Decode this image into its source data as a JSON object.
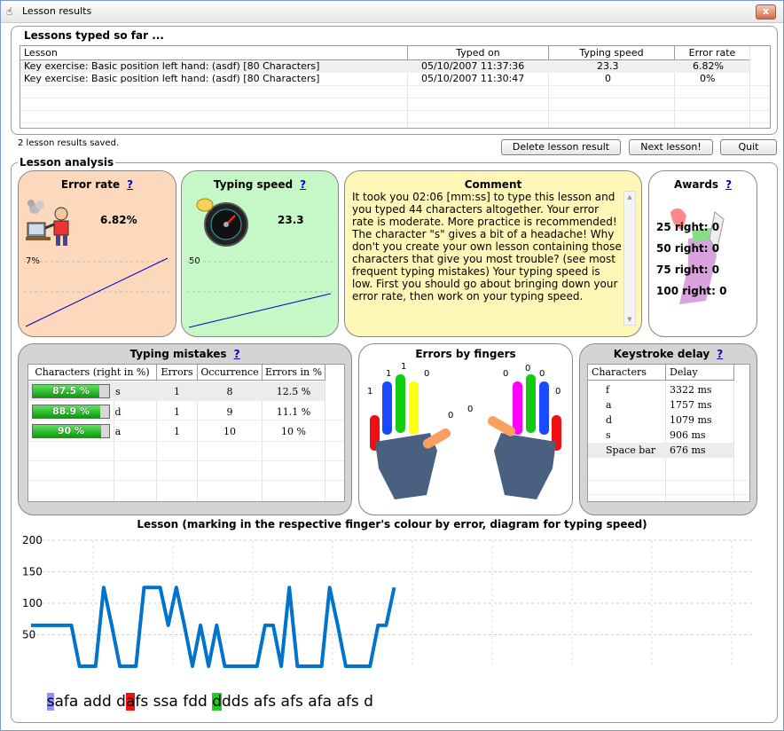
{
  "window": {
    "title": "Lesson results",
    "close": "x"
  },
  "lessons": {
    "title": "Lessons typed so far ...",
    "columns": [
      "Lesson",
      "Typed on",
      "Typing speed",
      "Error rate"
    ],
    "rows": [
      {
        "lesson": "Key exercise: Basic position left hand: (asdf) [80 Characters]",
        "typed_on": "05/10/2007 11:37:36",
        "speed": "23.3",
        "error": "6.82%"
      },
      {
        "lesson": "Key exercise: Basic position left hand: (asdf) [80 Characters]",
        "typed_on": "05/10/2007 11:30:47",
        "speed": "0",
        "error": "0%"
      }
    ],
    "status": "2 lesson results saved."
  },
  "buttons": {
    "delete": "Delete lesson result",
    "next": "Next lesson!",
    "quit": "Quit"
  },
  "analysis": {
    "title": "Lesson analysis",
    "help": "?",
    "error_rate": {
      "title": "Error rate",
      "value": "6.82%",
      "axis_label": "7%"
    },
    "typing_speed": {
      "title": "Typing speed",
      "value": "23.3",
      "axis_label": "50"
    },
    "comment": {
      "title": "Comment",
      "text": "It took you 02:06 [mm:ss] to type this lesson and you typed 44 characters altogether. Your error rate is moderate. More practice is recommended! The character \"s\" gives a bit of a headache! Why don't you create your own lesson containing those characters that give you most trouble? (see most frequent typing mistakes) Your typing speed is low. First you should go about bringing down your error rate, then work on your typing speed."
    },
    "awards": {
      "title": "Awards",
      "rows": [
        "25 right: 0",
        "50 right: 0",
        "75 right: 0",
        "100 right: 0"
      ]
    },
    "mistakes": {
      "title": "Typing mistakes",
      "columns": [
        "Characters (right in %)",
        "Errors",
        "Occurrence",
        "Errors in %"
      ],
      "rows": [
        {
          "pct_label": "87.5 %",
          "pct": 87.5,
          "char": "s",
          "errors": "1",
          "occ": "8",
          "epct": "12.5 %"
        },
        {
          "pct_label": "88.9 %",
          "pct": 88.9,
          "char": "d",
          "errors": "1",
          "occ": "9",
          "epct": "11.1 %"
        },
        {
          "pct_label": "90 %",
          "pct": 90,
          "char": "a",
          "errors": "1",
          "occ": "10",
          "epct": "10 %"
        }
      ]
    },
    "fingers": {
      "title": "Errors by fingers",
      "left": [
        "1",
        "1",
        "1",
        "0",
        "0"
      ],
      "right": [
        "0",
        "0",
        "0",
        "0",
        "0"
      ]
    },
    "keystroke": {
      "title": "Keystroke delay",
      "columns": [
        "Characters",
        "Delay"
      ],
      "rows": [
        {
          "ch": "f",
          "d": "3322 ms"
        },
        {
          "ch": "a",
          "d": "1757 ms"
        },
        {
          "ch": "d",
          "d": "1079 ms"
        },
        {
          "ch": "s",
          "d": "906 ms"
        },
        {
          "ch": "Space bar",
          "d": "676 ms"
        }
      ]
    }
  },
  "lesson_chart": {
    "title": "Lesson (marking in the respective finger's colour by error, diagram for typing speed)",
    "text": "safa add dafs ssa fdd ddds afs afs afa afs d"
  },
  "chart_data": {
    "type": "line",
    "title": "Lesson (marking in the respective finger's colour by error, diagram for typing speed)",
    "ylim": [
      0,
      200
    ],
    "yticks": [
      "200",
      "150",
      "100",
      "50"
    ],
    "values": [
      65,
      65,
      65,
      65,
      65,
      65,
      0,
      0,
      0,
      125,
      65,
      0,
      0,
      0,
      125,
      125,
      125,
      65,
      125,
      65,
      0,
      65,
      0,
      65,
      0,
      0,
      0,
      0,
      0,
      65,
      65,
      0,
      125,
      0,
      0,
      0,
      0,
      125,
      65,
      0,
      0,
      0,
      0,
      65,
      65,
      125
    ]
  },
  "colors": {
    "accent": "#0000cc",
    "line": "#0073cc",
    "error_panel": "#fcd9bd",
    "speed_panel": "#c6f7c6",
    "comment_panel": "#fff7b8"
  }
}
